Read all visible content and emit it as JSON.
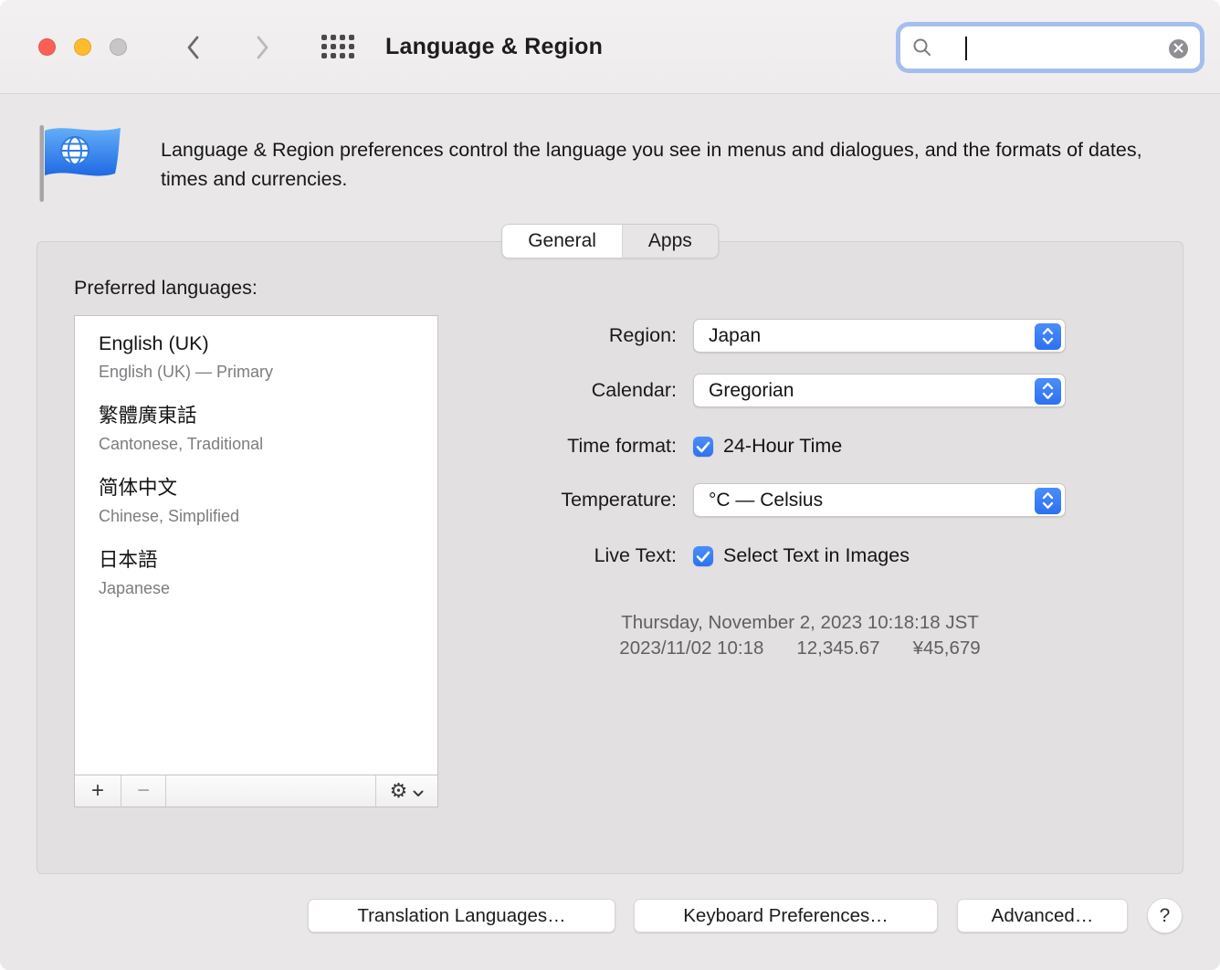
{
  "window": {
    "title": "Language & Region"
  },
  "titlebar": {
    "search_value": ""
  },
  "header": {
    "description": "Language & Region preferences control the language you see in menus and dialogues, and the formats of dates, times and currencies."
  },
  "tabs": [
    {
      "label": "General",
      "selected": true
    },
    {
      "label": "Apps",
      "selected": false
    }
  ],
  "preferred_languages": {
    "label": "Preferred languages:",
    "items": [
      {
        "name": "English (UK)",
        "detail": "English (UK) — Primary"
      },
      {
        "name": "繁體廣東話",
        "detail": "Cantonese, Traditional"
      },
      {
        "name": "简体中文",
        "detail": "Chinese, Simplified"
      },
      {
        "name": "日本語",
        "detail": "Japanese"
      }
    ],
    "toolbar": {
      "add": "+",
      "remove": "−",
      "gear": "⚙"
    }
  },
  "form": {
    "region": {
      "label": "Region:",
      "value": "Japan"
    },
    "calendar": {
      "label": "Calendar:",
      "value": "Gregorian"
    },
    "time_format": {
      "label": "Time format:",
      "option": "24-Hour Time",
      "checked": true
    },
    "temperature": {
      "label": "Temperature:",
      "value": "°C — Celsius"
    },
    "live_text": {
      "label": "Live Text:",
      "option": "Select Text in Images",
      "checked": true
    }
  },
  "preview": {
    "line1": "Thursday, November 2, 2023 10:18:18 JST",
    "date": "2023/11/02 10:18",
    "number": "12,345.67",
    "currency": "¥45,679"
  },
  "footer": {
    "translation": "Translation Languages…",
    "keyboard": "Keyboard Preferences…",
    "advanced": "Advanced…",
    "help": "?"
  },
  "colors": {
    "accent": "#3478f6",
    "focus_ring": "#568ff6"
  }
}
